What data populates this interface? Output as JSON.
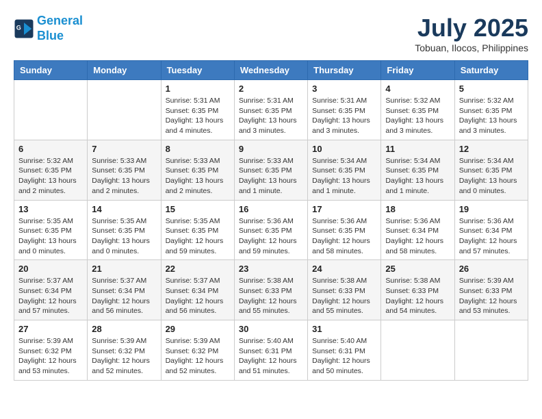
{
  "header": {
    "logo_line1": "General",
    "logo_line2": "Blue",
    "month_year": "July 2025",
    "location": "Tobuan, Ilocos, Philippines"
  },
  "weekdays": [
    "Sunday",
    "Monday",
    "Tuesday",
    "Wednesday",
    "Thursday",
    "Friday",
    "Saturday"
  ],
  "weeks": [
    [
      {
        "day": "",
        "info": ""
      },
      {
        "day": "",
        "info": ""
      },
      {
        "day": "1",
        "info": "Sunrise: 5:31 AM\nSunset: 6:35 PM\nDaylight: 13 hours\nand 4 minutes."
      },
      {
        "day": "2",
        "info": "Sunrise: 5:31 AM\nSunset: 6:35 PM\nDaylight: 13 hours\nand 3 minutes."
      },
      {
        "day": "3",
        "info": "Sunrise: 5:31 AM\nSunset: 6:35 PM\nDaylight: 13 hours\nand 3 minutes."
      },
      {
        "day": "4",
        "info": "Sunrise: 5:32 AM\nSunset: 6:35 PM\nDaylight: 13 hours\nand 3 minutes."
      },
      {
        "day": "5",
        "info": "Sunrise: 5:32 AM\nSunset: 6:35 PM\nDaylight: 13 hours\nand 3 minutes."
      }
    ],
    [
      {
        "day": "6",
        "info": "Sunrise: 5:32 AM\nSunset: 6:35 PM\nDaylight: 13 hours\nand 2 minutes."
      },
      {
        "day": "7",
        "info": "Sunrise: 5:33 AM\nSunset: 6:35 PM\nDaylight: 13 hours\nand 2 minutes."
      },
      {
        "day": "8",
        "info": "Sunrise: 5:33 AM\nSunset: 6:35 PM\nDaylight: 13 hours\nand 2 minutes."
      },
      {
        "day": "9",
        "info": "Sunrise: 5:33 AM\nSunset: 6:35 PM\nDaylight: 13 hours\nand 1 minute."
      },
      {
        "day": "10",
        "info": "Sunrise: 5:34 AM\nSunset: 6:35 PM\nDaylight: 13 hours\nand 1 minute."
      },
      {
        "day": "11",
        "info": "Sunrise: 5:34 AM\nSunset: 6:35 PM\nDaylight: 13 hours\nand 1 minute."
      },
      {
        "day": "12",
        "info": "Sunrise: 5:34 AM\nSunset: 6:35 PM\nDaylight: 13 hours\nand 0 minutes."
      }
    ],
    [
      {
        "day": "13",
        "info": "Sunrise: 5:35 AM\nSunset: 6:35 PM\nDaylight: 13 hours\nand 0 minutes."
      },
      {
        "day": "14",
        "info": "Sunrise: 5:35 AM\nSunset: 6:35 PM\nDaylight: 13 hours\nand 0 minutes."
      },
      {
        "day": "15",
        "info": "Sunrise: 5:35 AM\nSunset: 6:35 PM\nDaylight: 12 hours\nand 59 minutes."
      },
      {
        "day": "16",
        "info": "Sunrise: 5:36 AM\nSunset: 6:35 PM\nDaylight: 12 hours\nand 59 minutes."
      },
      {
        "day": "17",
        "info": "Sunrise: 5:36 AM\nSunset: 6:35 PM\nDaylight: 12 hours\nand 58 minutes."
      },
      {
        "day": "18",
        "info": "Sunrise: 5:36 AM\nSunset: 6:34 PM\nDaylight: 12 hours\nand 58 minutes."
      },
      {
        "day": "19",
        "info": "Sunrise: 5:36 AM\nSunset: 6:34 PM\nDaylight: 12 hours\nand 57 minutes."
      }
    ],
    [
      {
        "day": "20",
        "info": "Sunrise: 5:37 AM\nSunset: 6:34 PM\nDaylight: 12 hours\nand 57 minutes."
      },
      {
        "day": "21",
        "info": "Sunrise: 5:37 AM\nSunset: 6:34 PM\nDaylight: 12 hours\nand 56 minutes."
      },
      {
        "day": "22",
        "info": "Sunrise: 5:37 AM\nSunset: 6:34 PM\nDaylight: 12 hours\nand 56 minutes."
      },
      {
        "day": "23",
        "info": "Sunrise: 5:38 AM\nSunset: 6:33 PM\nDaylight: 12 hours\nand 55 minutes."
      },
      {
        "day": "24",
        "info": "Sunrise: 5:38 AM\nSunset: 6:33 PM\nDaylight: 12 hours\nand 55 minutes."
      },
      {
        "day": "25",
        "info": "Sunrise: 5:38 AM\nSunset: 6:33 PM\nDaylight: 12 hours\nand 54 minutes."
      },
      {
        "day": "26",
        "info": "Sunrise: 5:39 AM\nSunset: 6:33 PM\nDaylight: 12 hours\nand 53 minutes."
      }
    ],
    [
      {
        "day": "27",
        "info": "Sunrise: 5:39 AM\nSunset: 6:32 PM\nDaylight: 12 hours\nand 53 minutes."
      },
      {
        "day": "28",
        "info": "Sunrise: 5:39 AM\nSunset: 6:32 PM\nDaylight: 12 hours\nand 52 minutes."
      },
      {
        "day": "29",
        "info": "Sunrise: 5:39 AM\nSunset: 6:32 PM\nDaylight: 12 hours\nand 52 minutes."
      },
      {
        "day": "30",
        "info": "Sunrise: 5:40 AM\nSunset: 6:31 PM\nDaylight: 12 hours\nand 51 minutes."
      },
      {
        "day": "31",
        "info": "Sunrise: 5:40 AM\nSunset: 6:31 PM\nDaylight: 12 hours\nand 50 minutes."
      },
      {
        "day": "",
        "info": ""
      },
      {
        "day": "",
        "info": ""
      }
    ]
  ]
}
